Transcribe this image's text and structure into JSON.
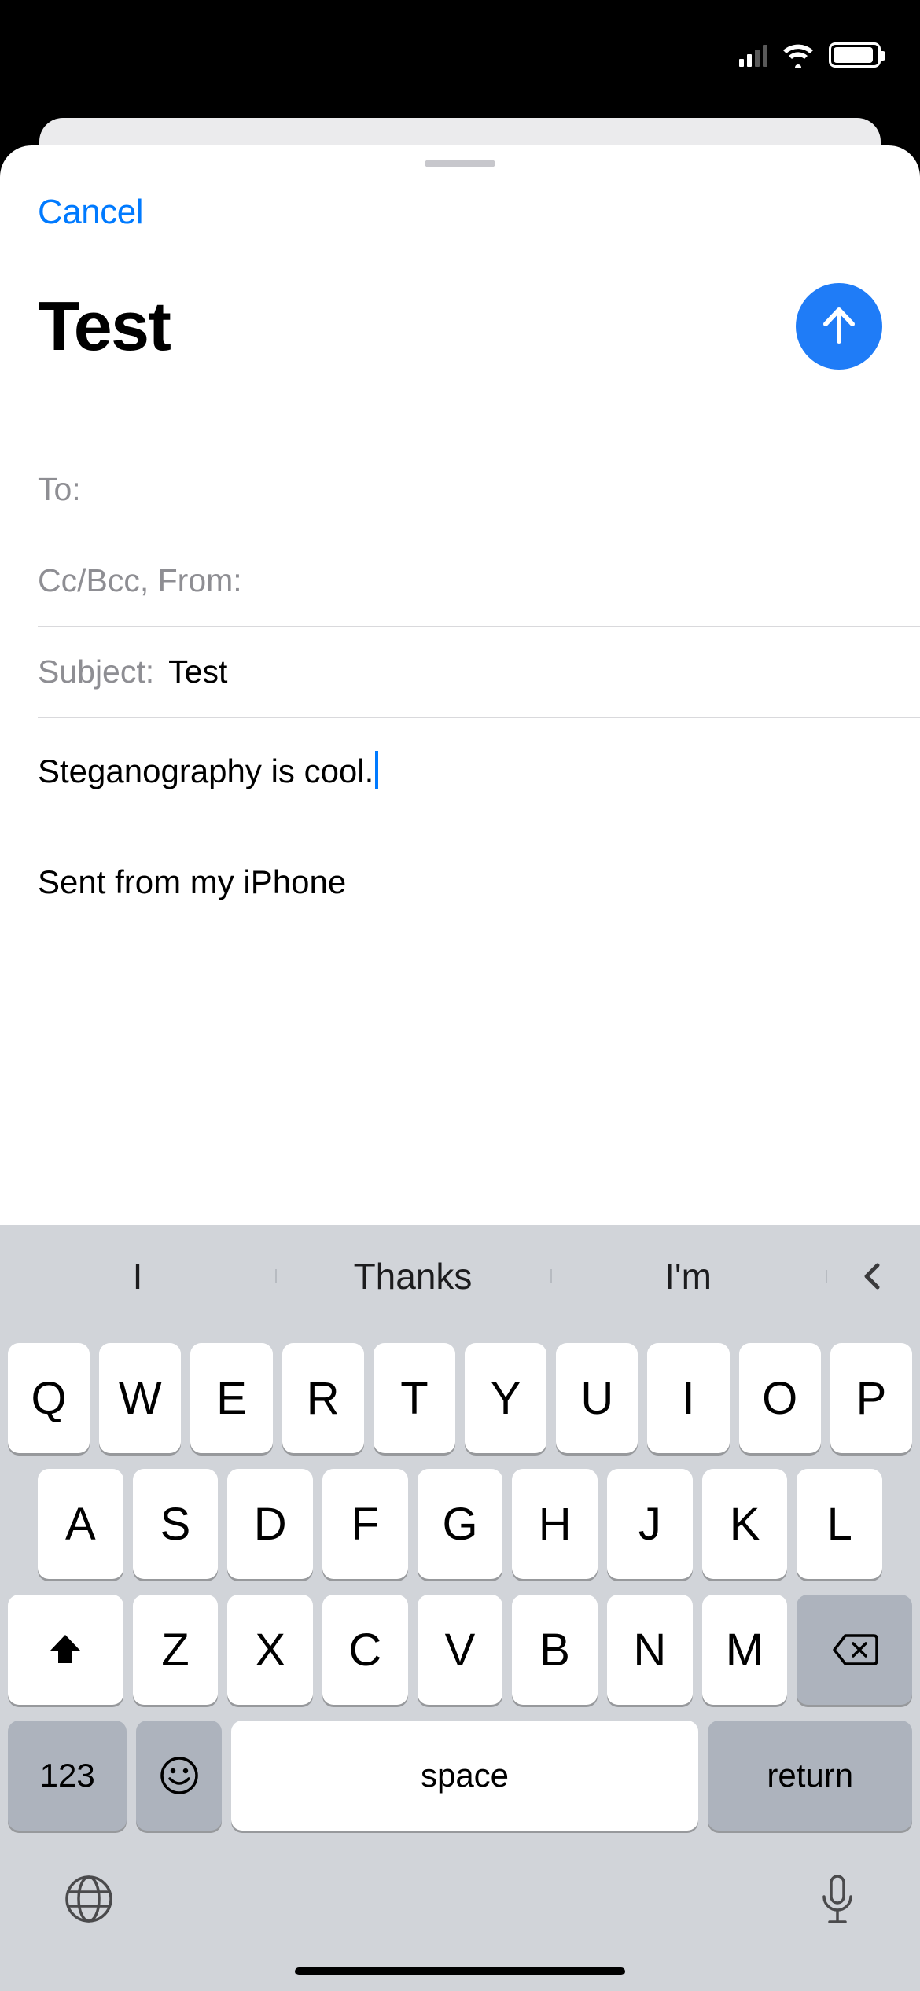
{
  "statusbar": {
    "cell_strength": 2,
    "wifi": true,
    "battery_fill_pct": 88
  },
  "sheet": {
    "cancel_label": "Cancel",
    "title": "Test",
    "fields": {
      "to_label": "To:",
      "to_value": "",
      "ccbcc_label": "Cc/Bcc, From:",
      "ccbcc_value": "",
      "subject_label": "Subject:",
      "subject_value": "Test"
    },
    "body_text": "Steganography is cool.",
    "signature": "Sent from my iPhone"
  },
  "keyboard": {
    "suggestions": [
      "I",
      "Thanks",
      "I'm"
    ],
    "row1": [
      "Q",
      "W",
      "E",
      "R",
      "T",
      "Y",
      "U",
      "I",
      "O",
      "P"
    ],
    "row2": [
      "A",
      "S",
      "D",
      "F",
      "G",
      "H",
      "J",
      "K",
      "L"
    ],
    "row3": [
      "Z",
      "X",
      "C",
      "V",
      "B",
      "N",
      "M"
    ],
    "numeric_label": "123",
    "space_label": "space",
    "return_label": "return"
  }
}
